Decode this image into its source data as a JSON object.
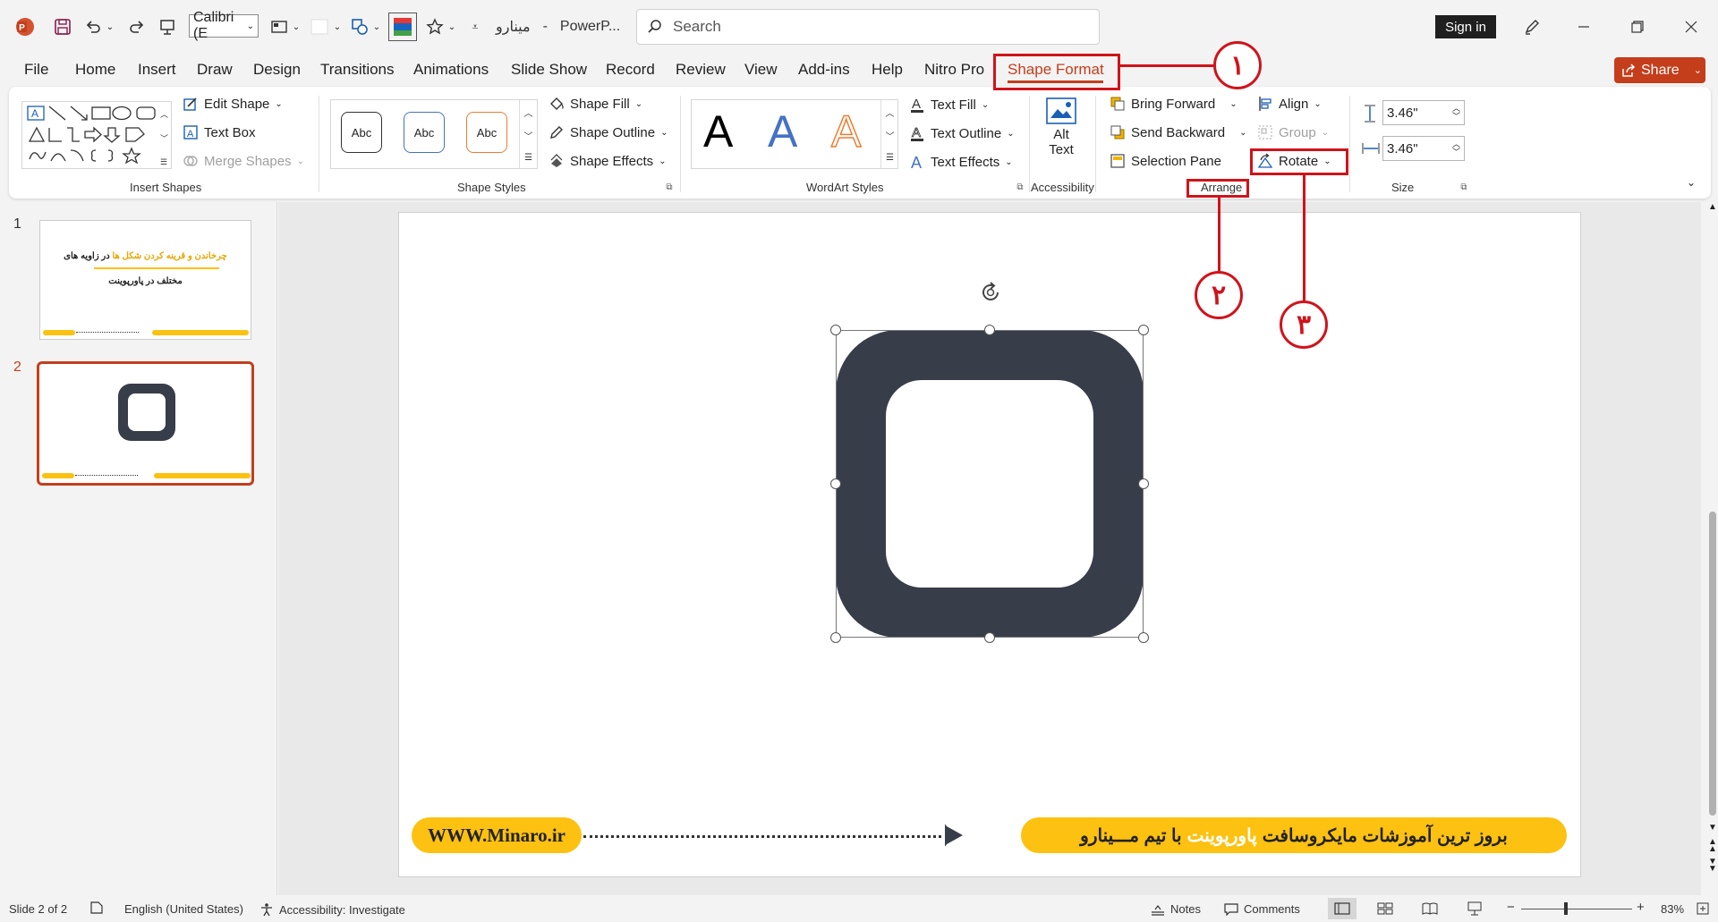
{
  "app": {
    "doc_name": "مینارو",
    "app_name": "PowerP...",
    "sign_in": "Sign in",
    "share": "Share"
  },
  "toolbar": {
    "font_name": "Calibri (E"
  },
  "search": {
    "placeholder": "Search"
  },
  "menu": {
    "tabs": [
      "File",
      "Home",
      "Insert",
      "Draw",
      "Design",
      "Transitions",
      "Animations",
      "Slide Show",
      "Record",
      "Review",
      "View",
      "Add-ins",
      "Help",
      "Nitro Pro",
      "Shape Format"
    ],
    "active": "Shape Format"
  },
  "ribbon": {
    "insert_shapes": {
      "edit_shape": "Edit Shape",
      "text_box": "Text Box",
      "merge_shapes": "Merge Shapes",
      "group_label": "Insert Shapes"
    },
    "shape_styles": {
      "sample": "Abc",
      "fill": "Shape Fill",
      "outline": "Shape Outline",
      "effects": "Shape Effects",
      "group_label": "Shape Styles",
      "sample_colors": [
        "#333333",
        "#4472c4",
        "#ed7d31"
      ]
    },
    "wordart": {
      "letter": "A",
      "fill": "Text Fill",
      "outline": "Text Outline",
      "effects": "Text Effects",
      "group_label": "WordArt Styles",
      "letter_colors": [
        "#000000",
        "#4472c4",
        "#ed7d31"
      ]
    },
    "accessibility": {
      "alt_line1": "Alt",
      "alt_line2": "Text",
      "group_label": "Accessibility"
    },
    "arrange": {
      "bring_forward": "Bring Forward",
      "send_backward": "Send Backward",
      "selection_pane": "Selection Pane",
      "align": "Align",
      "group": "Group",
      "rotate": "Rotate",
      "group_label": "Arrange"
    },
    "size": {
      "height": "3.46\"",
      "width": "3.46\"",
      "group_label": "Size"
    }
  },
  "annotations": {
    "step1": "۱",
    "step2": "۲",
    "step3": "۳",
    "color": "#d0131b"
  },
  "thumbnails": [
    {
      "number": "1",
      "title_line1_yellow": "چرخاندن و قرینه کردن شکل ها",
      "title_line1_rest": "در زاویه های",
      "title_line2": "مختلف در پاورپوینت"
    },
    {
      "number": "2"
    }
  ],
  "slide": {
    "shape_color": "#383d4a",
    "url": "WWW.Minaro.ir",
    "footer_part1": "بروز ترین آموزشات مایکروسافت",
    "footer_highlight": "پاورپوینت",
    "footer_part2": "با تیم مـــینارو",
    "accent": "#fcc111"
  },
  "status": {
    "slide": "Slide 2 of 2",
    "language": "English (United States)",
    "accessibility": "Accessibility: Investigate",
    "notes": "Notes",
    "comments": "Comments",
    "zoom": "83%"
  }
}
